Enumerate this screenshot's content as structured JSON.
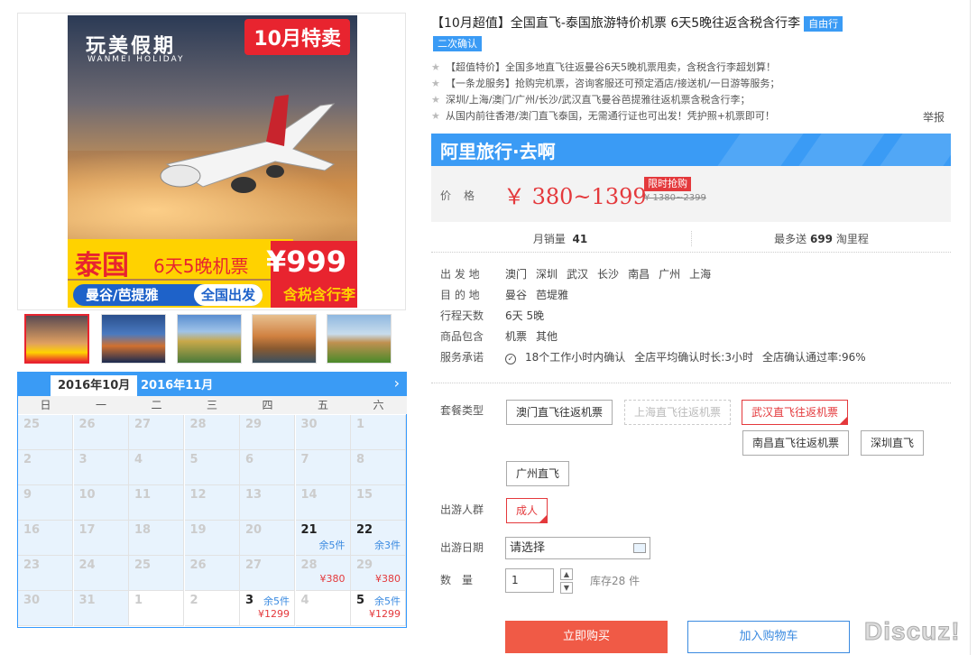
{
  "gallery": {
    "brand": "玩美假期",
    "brand_sub": "WANMEI HOLIDAY",
    "promo_tag": "10月特卖",
    "banner_country": "泰国",
    "banner_trip": "6天5晚机票",
    "banner_dest": "曼谷/芭提雅",
    "banner_depart": "全国出发",
    "banner_price": "¥999",
    "banner_note": "含税含行李"
  },
  "calendar": {
    "current_month": "2016年10月",
    "next_month": "2016年11月",
    "weekdays": [
      "日",
      "一",
      "二",
      "三",
      "四",
      "五",
      "六"
    ],
    "weeks": [
      [
        {
          "d": "25"
        },
        {
          "d": "26"
        },
        {
          "d": "27"
        },
        {
          "d": "28"
        },
        {
          "d": "29"
        },
        {
          "d": "30"
        },
        {
          "d": "1"
        }
      ],
      [
        {
          "d": "2"
        },
        {
          "d": "3"
        },
        {
          "d": "4"
        },
        {
          "d": "5"
        },
        {
          "d": "6"
        },
        {
          "d": "7"
        },
        {
          "d": "8"
        }
      ],
      [
        {
          "d": "9"
        },
        {
          "d": "10"
        },
        {
          "d": "11"
        },
        {
          "d": "12"
        },
        {
          "d": "13"
        },
        {
          "d": "14"
        },
        {
          "d": "15"
        }
      ],
      [
        {
          "d": "16"
        },
        {
          "d": "17"
        },
        {
          "d": "18"
        },
        {
          "d": "19"
        },
        {
          "d": "20"
        },
        {
          "d": "21",
          "stock": "余5件",
          "avail": true
        },
        {
          "d": "22",
          "stock": "余3件",
          "avail": true
        }
      ],
      [
        {
          "d": "23"
        },
        {
          "d": "24"
        },
        {
          "d": "25"
        },
        {
          "d": "26"
        },
        {
          "d": "27"
        },
        {
          "d": "28",
          "price": "¥380"
        },
        {
          "d": "29",
          "price": "¥380"
        }
      ],
      [
        {
          "d": "30"
        },
        {
          "d": "31"
        },
        {
          "d": "1",
          "blank": true
        },
        {
          "d": "2",
          "blank": true
        },
        {
          "d": "3",
          "stock": "余5件",
          "price": "¥1299",
          "avail": true,
          "blank": true
        },
        {
          "d": "4",
          "blank": true
        },
        {
          "d": "5",
          "stock": "余5件",
          "price": "¥1299",
          "avail": true,
          "blank": true
        }
      ]
    ]
  },
  "product": {
    "title": "【10月超值】全国直飞-泰国旅游特价机票 6天5晚往返含税含行李",
    "tag1": "自由行",
    "tag2": "二次确认",
    "highlights": [
      "【超值特价】全国多地直飞往返曼谷6天5晚机票甩卖，含税含行李超划算！",
      "【一条龙服务】抢购完机票，咨询客服还可预定酒店/接送机/一日游等服务；",
      "深圳/上海/澳门/广州/长沙/武汉直飞曼谷芭提雅往返机票含税含行李；",
      "从国内前往香港/澳门直飞泰国，无需通行证也可出发！凭护照+机票即可！"
    ],
    "report": "举报",
    "brand_line": "阿里旅行·去啊",
    "price_label": "价格",
    "price": "￥ 380~1399",
    "flash_tag": "限时抢购",
    "orig_price": "¥ 1380~2399",
    "sales_label": "月销量",
    "sales_value": "41",
    "points_prefix": "最多送",
    "points_value": "699",
    "points_suffix": "淘里程"
  },
  "attrs": {
    "depart_label": "出 发 地",
    "depart_values": [
      "澳门",
      "深圳",
      "武汉",
      "长沙",
      "南昌",
      "广州",
      "上海"
    ],
    "dest_label": "目 的 地",
    "dest_values": [
      "曼谷",
      "芭堤雅"
    ],
    "days_label": "行程天数",
    "days_value": "6天 5晚",
    "includes_label": "商品包含",
    "includes_values": [
      "机票",
      "其他"
    ],
    "service_label": "服务承诺",
    "service_values": [
      "18个工作小时内确认",
      "全店平均确认时长:3小时",
      "全店确认通过率:96%"
    ]
  },
  "options": {
    "package_label": "套餐类型",
    "packages": [
      "澳门直飞往返机票",
      "上海直飞往返机票",
      "武汉直飞往返机票",
      "南昌直飞往返机票",
      "深圳直飞",
      "广州直飞"
    ],
    "group_label": "出游人群",
    "group_value": "成人",
    "date_label": "出游日期",
    "date_value": "请选择",
    "qty_label": "数　量",
    "qty_value": "1",
    "stock": "库存28 件",
    "buy": "立即购买",
    "cart": "加入购物车"
  },
  "watermark": "Discuz!"
}
